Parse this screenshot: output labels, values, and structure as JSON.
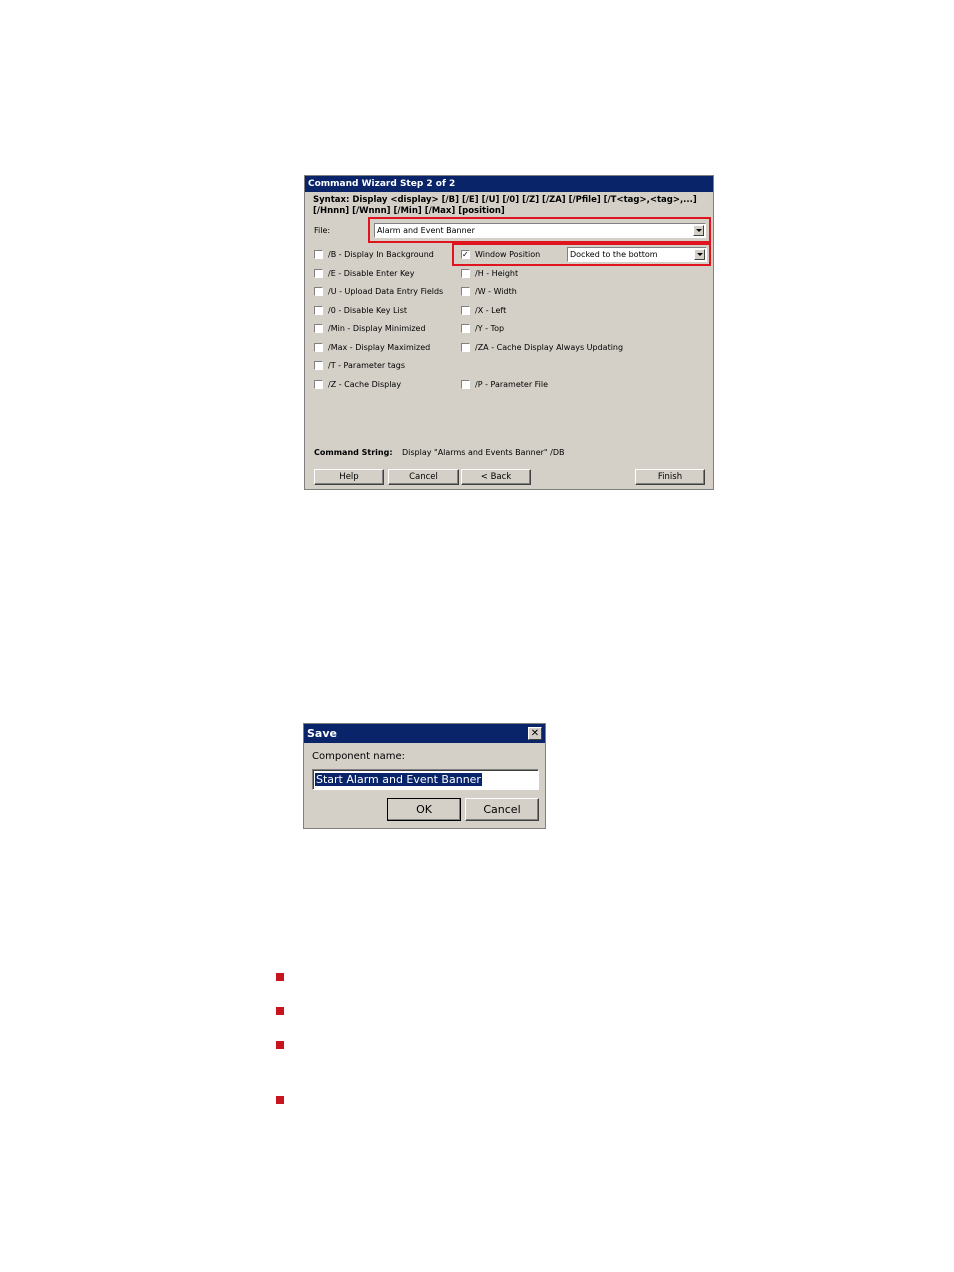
{
  "wizard": {
    "title": "Command Wizard Step 2 of 2",
    "syntax_line1": "Syntax: Display <display> [/B] [/E] [/U] [/0] [/Z] [/ZA] [/Pfile] [/T<tag>,<tag>,...]",
    "syntax_line2": "[/Hnnn] [/Wnnn] [/Min] [/Max] [position]",
    "file_label": "File:",
    "file_value": "Alarm and Event Banner",
    "left_options": [
      {
        "label": "/B - Display In Background",
        "checked": false
      },
      {
        "label": "/E - Disable Enter Key",
        "checked": false
      },
      {
        "label": "/U - Upload Data Entry Fields",
        "checked": false
      },
      {
        "label": "/0 - Disable Key List",
        "checked": false
      },
      {
        "label": "/Min - Display Minimized",
        "checked": false
      },
      {
        "label": "/Max - Display Maximized",
        "checked": false
      },
      {
        "label": "/T - Parameter tags",
        "checked": false
      },
      {
        "label": "/Z - Cache Display",
        "checked": false
      }
    ],
    "right_options": [
      {
        "label": "Window Position",
        "checked": true
      },
      {
        "label": "/H - Height",
        "checked": false
      },
      {
        "label": "/W - Width",
        "checked": false
      },
      {
        "label": "/X - Left",
        "checked": false
      },
      {
        "label": "/Y - Top",
        "checked": false
      },
      {
        "label": "/ZA - Cache Display Always Updating",
        "checked": false
      },
      {
        "label": "/P - Parameter File",
        "checked": false
      }
    ],
    "position_value": "Docked to the bottom",
    "command_string_label": "Command String:",
    "command_string_value": "Display \"Alarms and Events Banner\" /DB",
    "buttons": {
      "help": "Help",
      "cancel": "Cancel",
      "back": "< Back",
      "finish": "Finish"
    }
  },
  "save_dialog": {
    "title": "Save",
    "close_glyph": "✕",
    "component_label": "Component name:",
    "component_value": "Start Alarm and Event Banner",
    "ok": "OK",
    "cancel": "Cancel"
  },
  "colors": {
    "highlight": "#e0141e",
    "bullet": "#c8141e",
    "titlebar": "#0a246a"
  }
}
